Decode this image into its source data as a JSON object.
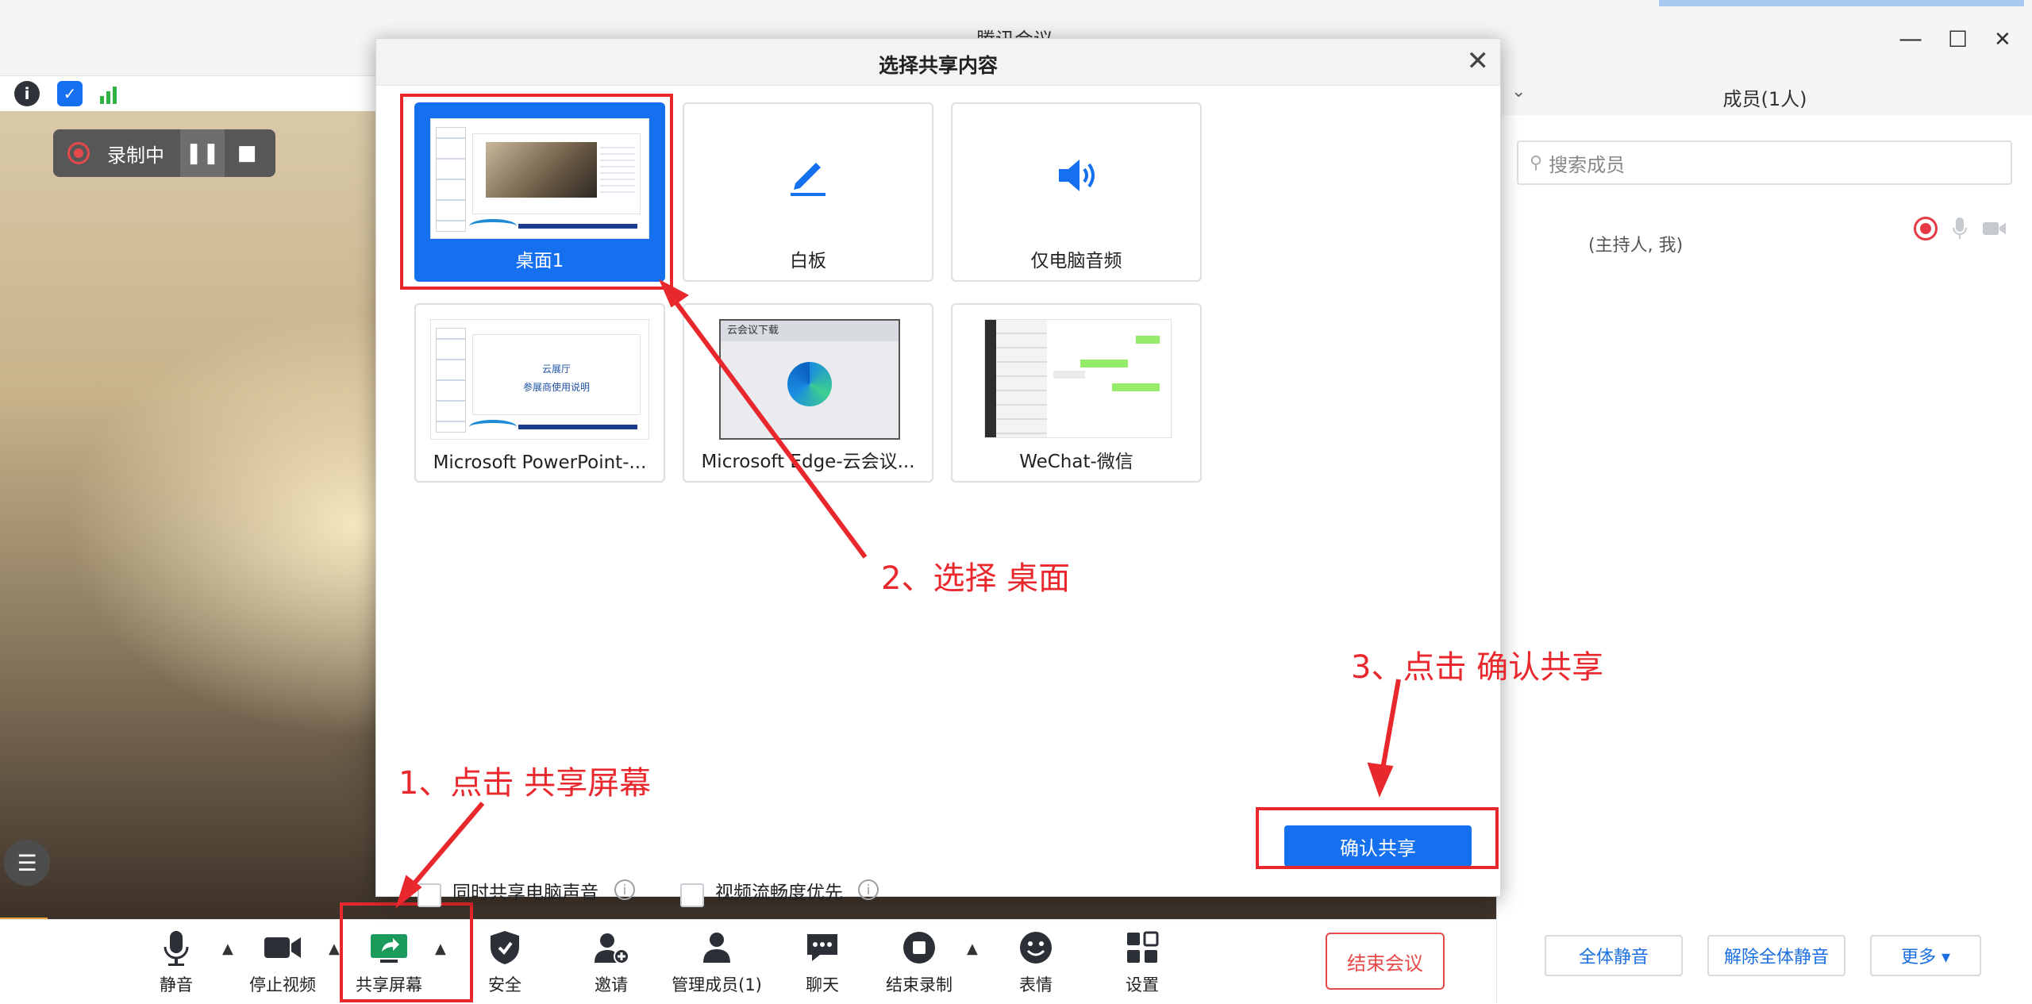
{
  "window": {
    "title": "腾讯会议",
    "controls": {
      "minimize": "—",
      "maximize": "☐",
      "close": "✕"
    }
  },
  "video": {
    "recording_label": "录制中",
    "pause_icon": "❚❚",
    "stop_icon": "■"
  },
  "dialog": {
    "title": "选择共享内容",
    "close_icon": "✕",
    "cards": [
      {
        "label": "桌面1",
        "selected": true
      },
      {
        "label": "白板",
        "icon": "pencil-icon"
      },
      {
        "label": "仅电脑音频",
        "icon": "speaker-icon"
      },
      {
        "label": "Microsoft PowerPoint-...",
        "thumb_title": "云展厅",
        "thumb_subtitle": "参展商使用说明"
      },
      {
        "label": "Microsoft Edge-云会议...",
        "thumb_tab": "云会议下载"
      },
      {
        "label": "WeChat-微信"
      }
    ],
    "options": [
      {
        "label": "同时共享电脑声音",
        "checked": false
      },
      {
        "label": "视频流畅度优先",
        "checked": false
      }
    ],
    "confirm_label": "确认共享"
  },
  "sidebar": {
    "header": "成员(1人)",
    "search_placeholder": "搜索成员",
    "member_role": "(主持人, 我)",
    "buttons": {
      "mute_all": "全体静音",
      "unmute_all": "解除全体静音",
      "more": "更多 ▾"
    }
  },
  "toolbar": {
    "items": [
      {
        "label": "静音",
        "icon": "microphone-icon"
      },
      {
        "label": "停止视频",
        "icon": "camera-icon"
      },
      {
        "label": "共享屏幕",
        "icon": "share-screen-icon"
      },
      {
        "label": "安全",
        "icon": "shield-icon"
      },
      {
        "label": "邀请",
        "icon": "add-user-icon"
      },
      {
        "label": "管理成员(1)",
        "icon": "members-icon"
      },
      {
        "label": "聊天",
        "icon": "chat-icon"
      },
      {
        "label": "结束录制",
        "icon": "stop-record-icon"
      },
      {
        "label": "表情",
        "icon": "emoji-icon"
      },
      {
        "label": "设置",
        "icon": "grid-icon"
      }
    ],
    "end_meeting": "结束会议"
  },
  "annotations": {
    "step1": "1、点击  共享屏幕",
    "step2": "2、选择  桌面",
    "step3": "3、点击   确认共享",
    "color": "#e8282d"
  }
}
